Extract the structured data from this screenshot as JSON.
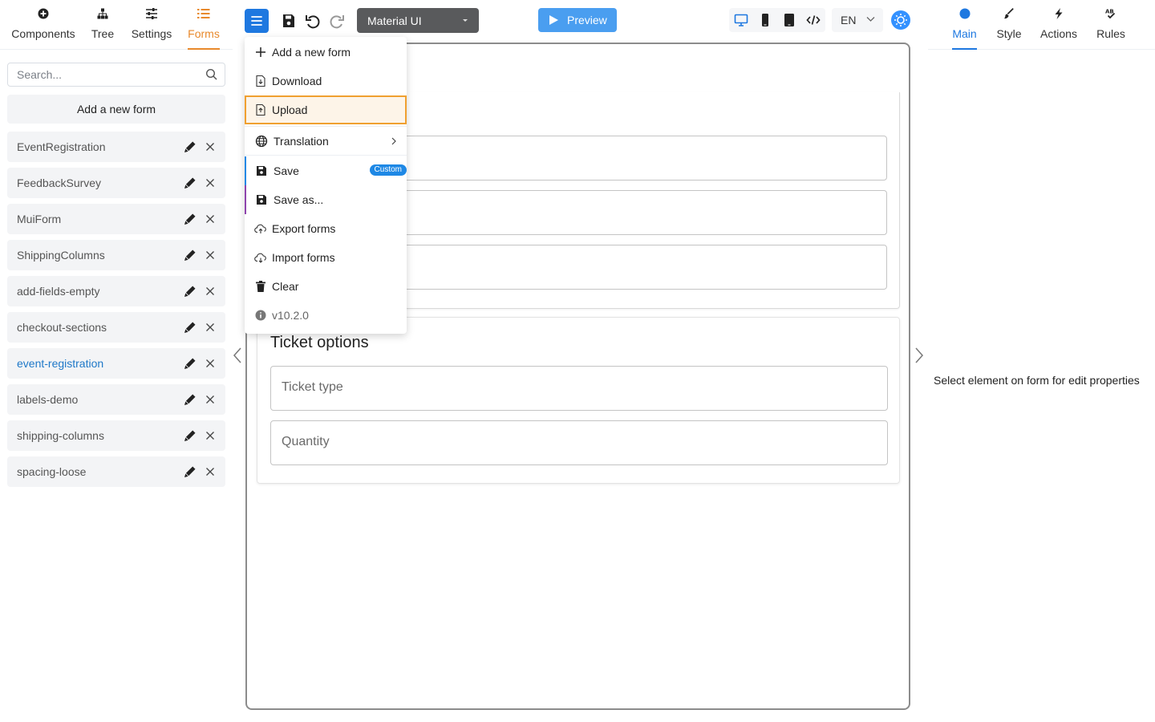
{
  "left_tabs": [
    {
      "label": "Components",
      "icon": "plus-circle-icon"
    },
    {
      "label": "Tree",
      "icon": "tree-icon"
    },
    {
      "label": "Settings",
      "icon": "sliders-icon"
    },
    {
      "label": "Forms",
      "icon": "list-icon",
      "active": true
    }
  ],
  "search": {
    "placeholder": "Search..."
  },
  "add_form_label": "Add a new form",
  "forms": [
    {
      "name": "EventRegistration"
    },
    {
      "name": "FeedbackSurvey"
    },
    {
      "name": "MuiForm"
    },
    {
      "name": "ShippingColumns"
    },
    {
      "name": "add-fields-empty"
    },
    {
      "name": "checkout-sections"
    },
    {
      "name": "event-registration",
      "selected": true
    },
    {
      "name": "labels-demo"
    },
    {
      "name": "shipping-columns"
    },
    {
      "name": "spacing-loose"
    }
  ],
  "toolbar": {
    "theme_value": "Material UI",
    "preview_label": "Preview",
    "language": "EN"
  },
  "menu": {
    "items": [
      {
        "label": "Add a new form",
        "icon": "plus-icon"
      },
      {
        "label": "Download",
        "icon": "file-download-icon"
      },
      {
        "label": "Upload",
        "icon": "file-upload-icon",
        "highlighted": true
      },
      {
        "label": "Translation",
        "icon": "globe-icon",
        "has_submenu": true
      },
      {
        "label": "Save",
        "icon": "floppy-icon",
        "badge": "Custom",
        "accent": "#1e88e5"
      },
      {
        "label": "Save as...",
        "icon": "floppy-icon",
        "accent": "#8e44ad"
      },
      {
        "label": "Export forms",
        "icon": "cloud-upload-icon"
      },
      {
        "label": "Import forms",
        "icon": "cloud-download-icon"
      },
      {
        "label": "Clear",
        "icon": "trash-icon"
      },
      {
        "label": "v10.2.0",
        "icon": "info-icon"
      }
    ]
  },
  "canvas": {
    "section2_title": "Ticket options",
    "fields": [
      "Ticket type",
      "Quantity"
    ]
  },
  "right_tabs": [
    {
      "label": "Main",
      "icon": "dot-icon",
      "active": true
    },
    {
      "label": "Style",
      "icon": "brush-icon"
    },
    {
      "label": "Actions",
      "icon": "lightning-icon"
    },
    {
      "label": "Rules",
      "icon": "spellcheck-icon"
    }
  ],
  "properties_hint": "Select element on form for edit properties",
  "colors": {
    "accent_orange": "#e8892c",
    "primary_blue": "#1e78e0",
    "highlight_border": "#f0a030"
  }
}
